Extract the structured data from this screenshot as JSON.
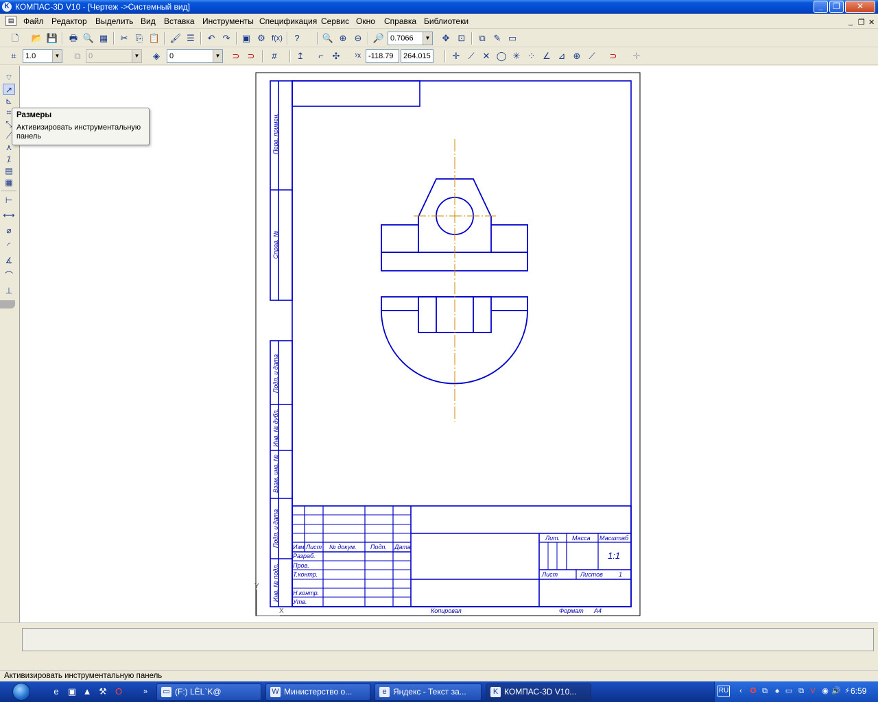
{
  "window": {
    "title": "КОМПАС-3D V10 - [Чертеж ->Системный вид]",
    "app_icon_letter": "K"
  },
  "menu": [
    "Файл",
    "Редактор",
    "Выделить",
    "Вид",
    "Вставка",
    "Инструменты",
    "Спецификация",
    "Сервис",
    "Окно",
    "Справка",
    "Библиотеки"
  ],
  "toolbar1": {
    "zoom_value": "0.7066"
  },
  "toolbar2": {
    "step_value": "1.0",
    "style_value": "0",
    "layer_value": "0",
    "x_coord": "-118.79",
    "y_coord": "264.015"
  },
  "tooltip": {
    "title": "Размеры",
    "body": "Активизировать инструментальную панель"
  },
  "drawing": {
    "side_labels": [
      "Перв. примен.",
      "Справ. №",
      "Подп. и дата",
      "Инв. № дубл.",
      "Взам. инв. №",
      "Подп. и дата",
      "Инв. № подл."
    ],
    "title_block": {
      "col_headers": [
        "Изм",
        "Лист",
        "№ докум.",
        "Подп.",
        "Дата"
      ],
      "rows": [
        "Разраб.",
        "Пров.",
        "Т.контр.",
        "Н.контр.",
        "Утв."
      ],
      "lit": "Лит.",
      "mass": "Масса",
      "scale_header": "Масштаб",
      "scale_value": "1:1",
      "sheet": "Лист",
      "sheets": "Листов",
      "sheets_count": "1"
    },
    "copied": "Копировал",
    "format_label": "Формат",
    "format_value": "А4",
    "axis_x": "X",
    "axis_y": "Y"
  },
  "status": {
    "text": "Активизировать инструментальную панель"
  },
  "taskbar": {
    "tasks": [
      "(F:) LÈL`K@",
      "Министерство о...",
      "Яндекс - Текст за...",
      "КОМПАС-3D V10..."
    ],
    "lang": "RU",
    "clock": "6:59"
  }
}
